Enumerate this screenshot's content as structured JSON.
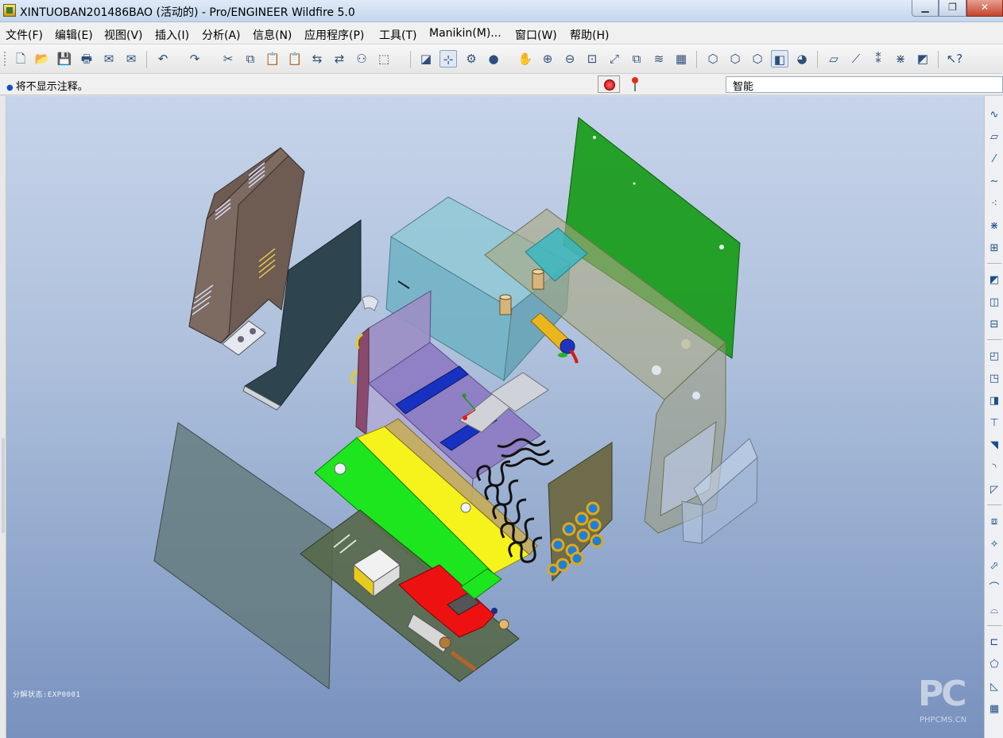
{
  "window": {
    "title": "XINTUOBAN201486BAO (活动的) - Pro/ENGINEER Wildfire 5.0",
    "min_label": "▁",
    "max_label": "❐",
    "close_label": "✕"
  },
  "menu": [
    "文件(F)",
    "编辑(E)",
    "视图(V)",
    "插入(I)",
    "分析(A)",
    "信息(N)",
    "应用程序(P)",
    "工具(T)",
    "Manikin(M)...",
    "窗口(W)",
    "帮助(H)"
  ],
  "toolbar": {
    "icons": [
      "new-file-icon",
      "open-folder-icon",
      "save-icon",
      "print-icon",
      "email-icon",
      "email-attach-icon",
      "undo-icon",
      "redo-icon",
      "cut-icon",
      "copy-icon",
      "paste-icon",
      "paste-special-icon",
      "regenerate-icon",
      "regen-manager-icon",
      "find-icon",
      "select-box-icon",
      "repaint-icon",
      "spin-center-icon",
      "orient-mode-icon",
      "shading-icon",
      "pan-icon",
      "zoom-in-icon",
      "zoom-out-icon",
      "refit-icon",
      "reorient-icon",
      "saved-views-icon",
      "layers-icon",
      "view-manager-icon",
      "wireframe-icon",
      "hidden-line-icon",
      "no-hidden-icon",
      "shaded-icon",
      "enhanced-realism-icon",
      "datum-planes-icon",
      "datum-axes-icon",
      "datum-points-icon",
      "datum-csys-icon",
      "annotations-icon",
      "context-help-icon"
    ]
  },
  "message": {
    "text": "将不显示注释。",
    "filter_value": "智能"
  },
  "viewport": {
    "explode_label": "分解状态:EXP0001",
    "watermark_logo": "PC",
    "watermark_text": "PHPCMS.CN"
  },
  "right_toolbar": {
    "icons": [
      "sketch-icon",
      "datum-plane-icon",
      "datum-axis-icon",
      "datum-curve-icon",
      "datum-point-icon",
      "point-offset-icon",
      "csys-icon",
      "assemble-icon",
      "create-component-icon",
      "component-list-icon",
      "extrude-icon",
      "revolve-icon",
      "sweep-icon",
      "blend-icon",
      "hole-icon",
      "round-icon",
      "chamfer-icon",
      "draft-icon",
      "shell-icon",
      "rib-icon",
      "mirror-icon",
      "pattern-icon",
      "merge-icon",
      "trim-icon",
      "offset-icon",
      "thicken-icon",
      "table-icon"
    ]
  },
  "colors": {
    "viewport_top": "#c7d4ea",
    "viewport_bottom": "#7891be",
    "green_panel": "#149a14",
    "yellow_plate": "#f6f21c",
    "bright_green": "#1ee61e",
    "red_part": "#ee1111",
    "blue_bar": "#1732c0",
    "teal_box": "#6fb1c4",
    "brown_cover": "#6e5b52",
    "slate_panel": "#2e4550"
  }
}
